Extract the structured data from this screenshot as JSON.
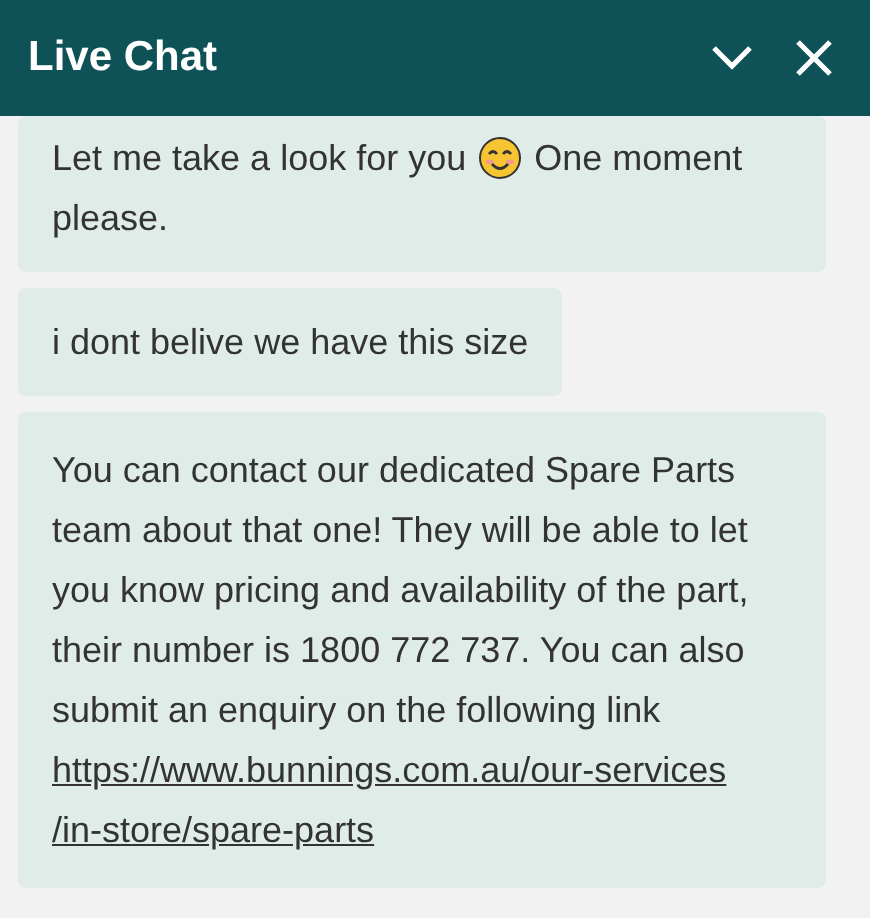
{
  "header": {
    "title": "Live Chat"
  },
  "messages": [
    {
      "kind": "emoji_text",
      "before": "Let me take a look for you",
      "after": "One moment",
      "after_line2": "please."
    },
    {
      "kind": "text",
      "text": "i dont belive we have this size"
    },
    {
      "kind": "link_text",
      "text": "You can contact our dedicated Spare Parts team about that one! They will be able to let you know pricing and availability of the part, their number is 1800 772 737. You can also submit an enquiry on the following link",
      "link": "https://www.bunnings.com.au/our-services",
      "link_cont": "/in-store/spare-parts"
    }
  ]
}
